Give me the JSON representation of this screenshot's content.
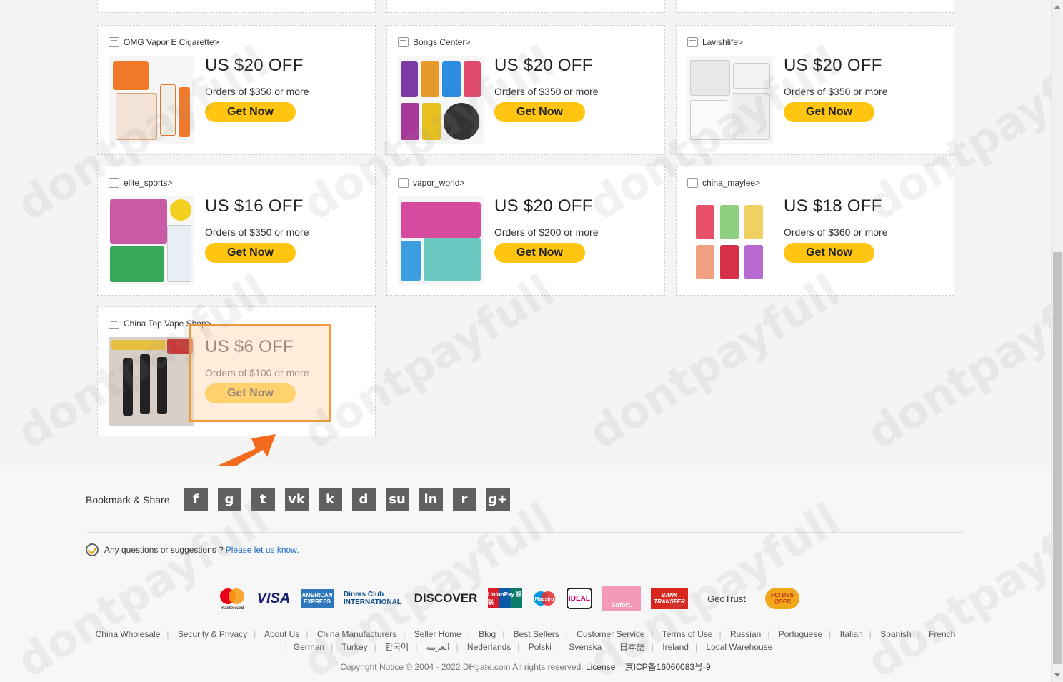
{
  "coupons": [
    {
      "store": "OMG Vapor E Cigarette>",
      "amount": "US $20 OFF",
      "condition": "Orders of $350 or more",
      "button": "Get Now"
    },
    {
      "store": "Bongs Center>",
      "amount": "US $20 OFF",
      "condition": "Orders of $350 or more",
      "button": "Get Now"
    },
    {
      "store": "Lavishlife>",
      "amount": "US $20 OFF",
      "condition": "Orders of $350 or more",
      "button": "Get Now"
    },
    {
      "store": "elite_sports>",
      "amount": "US $16 OFF",
      "condition": "Orders of $350 or more",
      "button": "Get Now"
    },
    {
      "store": "vapor_world>",
      "amount": "US $20 OFF",
      "condition": "Orders of $200 or more",
      "button": "Get Now"
    },
    {
      "store": "china_maylee>",
      "amount": "US $18 OFF",
      "condition": "Orders of $360 or more",
      "button": "Get Now"
    },
    {
      "store": "China Top Vape Shop>",
      "amount": "US $6 OFF",
      "condition": "Orders of $100 or more",
      "button": "Get Now"
    }
  ],
  "arrow_label": "dontpayfull",
  "watermark": "dontpayfull",
  "share": {
    "label": "Bookmark & Share",
    "icons": [
      "f",
      "g",
      "t",
      "vk",
      "k",
      "d",
      "su",
      "in",
      "r",
      "g+"
    ]
  },
  "question": {
    "text": "Any questions or suggestions ?",
    "link": "Please let us know."
  },
  "payments": [
    "mastercard",
    "VISA",
    "AMERICAN EXPRESS",
    "Diners Club INTERNATIONAL",
    "DISCOVER",
    "UnionPay 银联",
    "Maestro",
    "iDEAL",
    "Sofort.",
    "BANK TRANSFER",
    "GeoTrust",
    "PCI DSS @SEC"
  ],
  "footer_links_row1": [
    "China Wholesale",
    "Security & Privacy",
    "About Us",
    "China Manufacturers",
    "Seller Home",
    "Blog",
    "Best Sellers",
    "Customer Service",
    "Terms of Use",
    "Russian",
    "Portuguese",
    "Italian",
    "Spanish",
    "French"
  ],
  "footer_links_row2": [
    "German",
    "Turkey",
    "한국어",
    "العربية",
    "Nederlands",
    "Polski",
    "Svenska",
    "日本語",
    "Ireland",
    "Local Warehouse"
  ],
  "copyright": "Copyright Notice © 2004 - 2022 DHgate.com All rights reserved.",
  "license": "License",
  "icp": "京ICP备16060083号-9",
  "colors": {
    "button": "#ffc510",
    "highlight": "#f09a3a",
    "link": "#1a6fc9",
    "arrow": "#f26b1d"
  }
}
